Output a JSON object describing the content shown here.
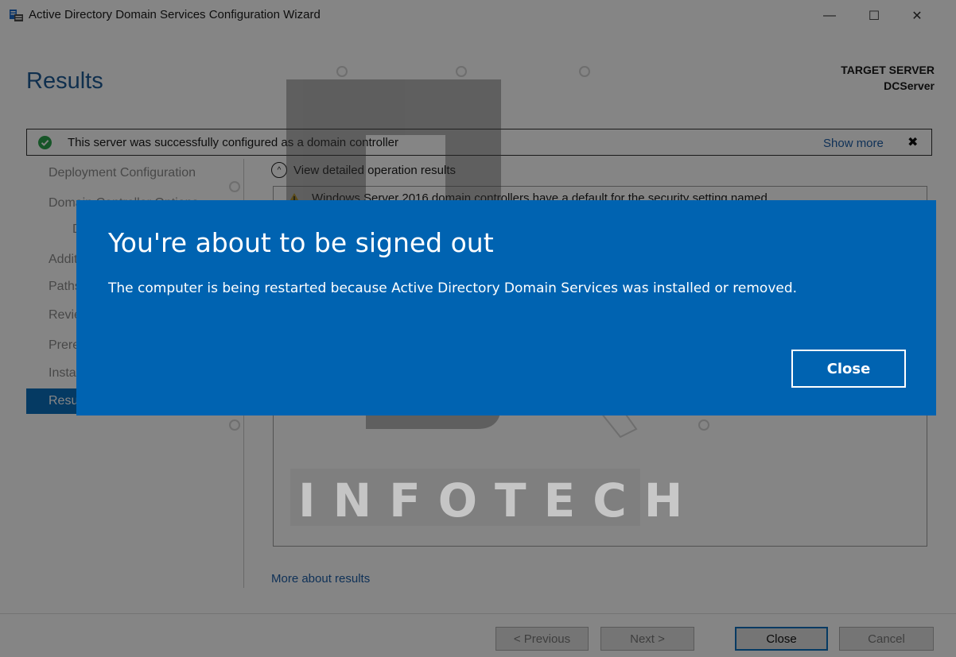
{
  "window": {
    "title": "Active Directory Domain Services Configuration Wizard",
    "controls": {
      "minimize": "—",
      "maximize": "☐",
      "close": "✕"
    }
  },
  "header": {
    "page_title": "Results",
    "target_label": "TARGET SERVER",
    "target_name": "DCServer"
  },
  "notification": {
    "text": "This server was successfully configured as a domain controller",
    "show_more": "Show more",
    "close_glyph": "✖"
  },
  "sidebar": {
    "items": [
      {
        "label": "Deployment Configuration"
      },
      {
        "label": "Domain Controller Options"
      },
      {
        "label": "DNS Options"
      },
      {
        "label": "Additional Options"
      },
      {
        "label": "Paths"
      },
      {
        "label": "Review Options"
      },
      {
        "label": "Prerequisites Check"
      },
      {
        "label": "Installation"
      },
      {
        "label": "Results"
      }
    ]
  },
  "content": {
    "expander_glyph": "^",
    "expander_label": "View detailed operation results",
    "warning_text": "Windows Server 2016 domain controllers have a default for the security setting named",
    "more_link": "More about results"
  },
  "footer": {
    "previous": "< Previous",
    "next": "Next >",
    "close": "Close",
    "cancel": "Cancel"
  },
  "watermark": {
    "text": "INFOTECH"
  },
  "signout": {
    "title": "You're about to be signed out",
    "message": "The computer is being restarted because Active Directory Domain Services was installed or removed.",
    "close_label": "Close"
  },
  "colors": {
    "dialog_blue": "#0063b1",
    "accent_blue": "#0b6fbf",
    "link_blue": "#1d5ea8",
    "title_blue": "#1d5b96",
    "success_green": "#2da44e",
    "warning_yellow": "#f2c21b"
  },
  "icons": {
    "app": "server-manager-icon",
    "success": "check-circle-icon",
    "warning": "warning-triangle-icon",
    "expander": "chevron-up-circle-icon"
  }
}
